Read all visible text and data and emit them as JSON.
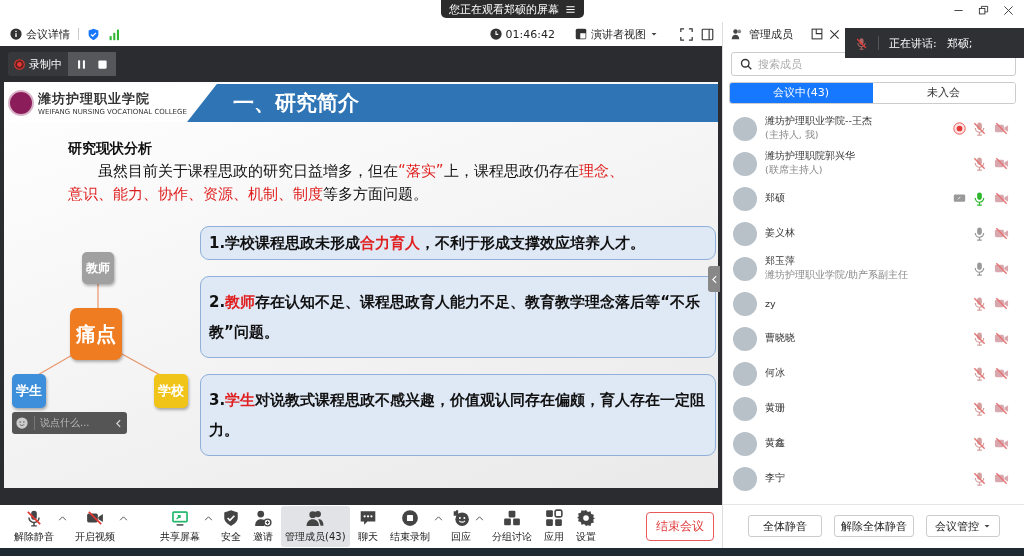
{
  "banner": {
    "text": "您正在观看郑硕的屏幕"
  },
  "header": {
    "meeting_info": "会议详情",
    "timer": "01:46:42",
    "view_mode": "演讲者视图"
  },
  "recording": {
    "label": "录制中"
  },
  "slide": {
    "school_name": "潍坊护理职业学院",
    "school_name_en": "WEIFANG NURSING VOCATIONAL COLLEGE",
    "title": "一、研究简介",
    "heading": "研究现状分析",
    "paragraph": [
      {
        "text": "虽然目前关于课程思政的研究日益增多，但在",
        "highlight": false
      },
      {
        "text": "“落实”",
        "highlight": true
      },
      {
        "text": "上，课程思政仍存在",
        "highlight": false
      },
      {
        "text": "理念、意识、能力、协作、资源、机制、制度",
        "highlight": true
      },
      {
        "text": "等多方面问题。",
        "highlight": false
      }
    ],
    "diagram": {
      "center": "痛点",
      "nodes": [
        {
          "label": "教师",
          "color": "#a0a0a0"
        },
        {
          "label": "学生",
          "color": "#3d8fdb"
        },
        {
          "label": "学校",
          "color": "#f0c419"
        }
      ]
    },
    "points": [
      {
        "segments": [
          {
            "text": "1.学校课程思政未形成",
            "highlight": false
          },
          {
            "text": "合力育人",
            "highlight": true
          },
          {
            "text": "，不利于形成支撑效应培养人才。",
            "highlight": false
          }
        ]
      },
      {
        "segments": [
          {
            "text": "2.",
            "highlight": false
          },
          {
            "text": "教师",
            "highlight": true
          },
          {
            "text": "存在认知不足、课程思政育人能力不足、教育教学理念落后等“不乐教”问题。",
            "highlight": false
          }
        ]
      },
      {
        "segments": [
          {
            "text": "3.",
            "highlight": false
          },
          {
            "text": "学生",
            "highlight": true
          },
          {
            "text": "对说教式课程思政不感兴趣，价值观认同存在偏颇，育人存在一定阻力。",
            "highlight": false
          }
        ]
      }
    ]
  },
  "chat": {
    "placeholder": "说点什么..."
  },
  "toolbar": {
    "items": [
      {
        "label": "解除静音",
        "kind": "unmute",
        "caret": true,
        "selected": false
      },
      {
        "label": "开启视频",
        "kind": "video",
        "caret": true,
        "selected": false
      },
      {
        "label": "共享屏幕",
        "kind": "share",
        "caret": true,
        "selected": false
      },
      {
        "label": "安全",
        "kind": "security",
        "caret": false,
        "selected": false
      },
      {
        "label": "邀请",
        "kind": "invite",
        "caret": false,
        "selected": false
      },
      {
        "label": "管理成员(43)",
        "kind": "participants",
        "caret": false,
        "selected": true
      },
      {
        "label": "聊天",
        "kind": "chat",
        "caret": false,
        "selected": false
      },
      {
        "label": "结束录制",
        "kind": "record",
        "caret": true,
        "selected": false
      },
      {
        "label": "回应",
        "kind": "reactions",
        "caret": true,
        "selected": false
      },
      {
        "label": "分组讨论",
        "kind": "breakout",
        "caret": false,
        "selected": false
      },
      {
        "label": "应用",
        "kind": "apps",
        "caret": false,
        "selected": false
      },
      {
        "label": "设置",
        "kind": "settings",
        "caret": false,
        "selected": false
      }
    ],
    "end_button": "结束会议"
  },
  "panel": {
    "title": "管理成员",
    "search": {
      "placeholder": "搜索成员"
    },
    "tabs": [
      {
        "label": "会议中(43)",
        "selected": true
      },
      {
        "label": "未入会",
        "selected": false
      }
    ],
    "members": [
      {
        "name": "潍坊护理职业学院--王杰",
        "role": "(主持人, 我)",
        "recording": true,
        "sharing": false,
        "muted": true,
        "speaking": false,
        "camera_on": false
      },
      {
        "name": "潍坊护理职院郭兴华",
        "role": "(联席主持人)",
        "recording": false,
        "sharing": false,
        "muted": true,
        "speaking": false,
        "camera_on": false
      },
      {
        "name": "郑硕",
        "recording": false,
        "sharing": true,
        "muted": false,
        "speaking": true,
        "camera_on": false
      },
      {
        "name": "姜义林",
        "recording": false,
        "sharing": false,
        "muted": false,
        "speaking": false,
        "camera_on": false
      },
      {
        "name": "郑玉萍",
        "role": "潍坊护理职业学院/助产系副主任",
        "recording": false,
        "sharing": false,
        "muted": false,
        "speaking": false,
        "camera_on": false
      },
      {
        "name": "zy",
        "recording": false,
        "sharing": false,
        "muted": true,
        "speaking": false,
        "camera_on": false
      },
      {
        "name": "曹晓晓",
        "recording": false,
        "sharing": false,
        "muted": true,
        "speaking": false,
        "camera_on": false
      },
      {
        "name": "何冰",
        "recording": false,
        "sharing": false,
        "muted": true,
        "speaking": false,
        "camera_on": false
      },
      {
        "name": "黄珊",
        "recording": false,
        "sharing": false,
        "muted": true,
        "speaking": false,
        "camera_on": false
      },
      {
        "name": "黄鑫",
        "recording": false,
        "sharing": false,
        "muted": true,
        "speaking": false,
        "camera_on": false
      },
      {
        "name": "李宁",
        "recording": false,
        "sharing": false,
        "muted": true,
        "speaking": false,
        "camera_on": false
      }
    ],
    "buttons": [
      {
        "label": "全体静音",
        "dropdown": false
      },
      {
        "label": "解除全体静音",
        "dropdown": false
      },
      {
        "label": "会议管控",
        "dropdown": true
      }
    ]
  },
  "speaker": {
    "label": "正在讲话:",
    "name": "郑硕;"
  }
}
